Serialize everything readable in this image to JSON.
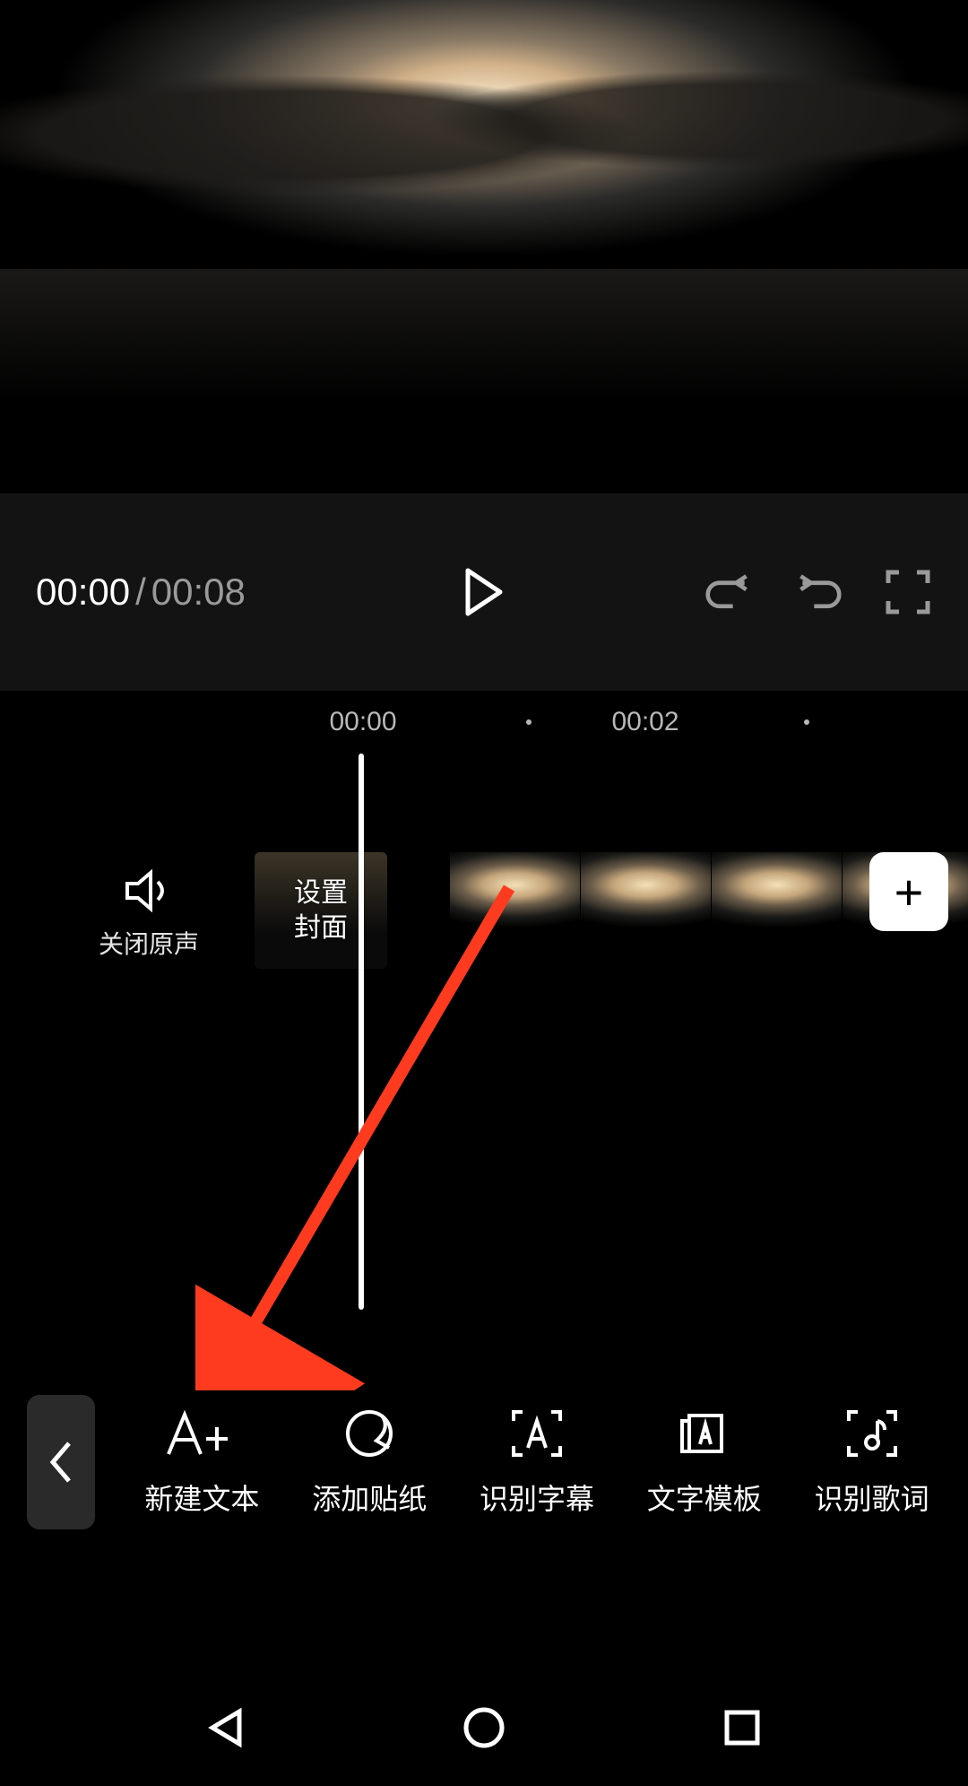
{
  "preview": {},
  "controls": {
    "current_time": "00:00",
    "separator": "/",
    "total_time": "00:08"
  },
  "timeline": {
    "ruler": {
      "tick_0": "00:00",
      "tick_2": "00:02"
    },
    "mute": {
      "label": "关闭原声"
    },
    "cover": {
      "label": "设置\n封面"
    },
    "add_clip": {
      "symbol": "+"
    }
  },
  "toolbar": {
    "items": [
      {
        "label": "新建文本"
      },
      {
        "label": "添加贴纸"
      },
      {
        "label": "识别字幕"
      },
      {
        "label": "文字模板"
      },
      {
        "label": "识别歌词"
      }
    ]
  }
}
